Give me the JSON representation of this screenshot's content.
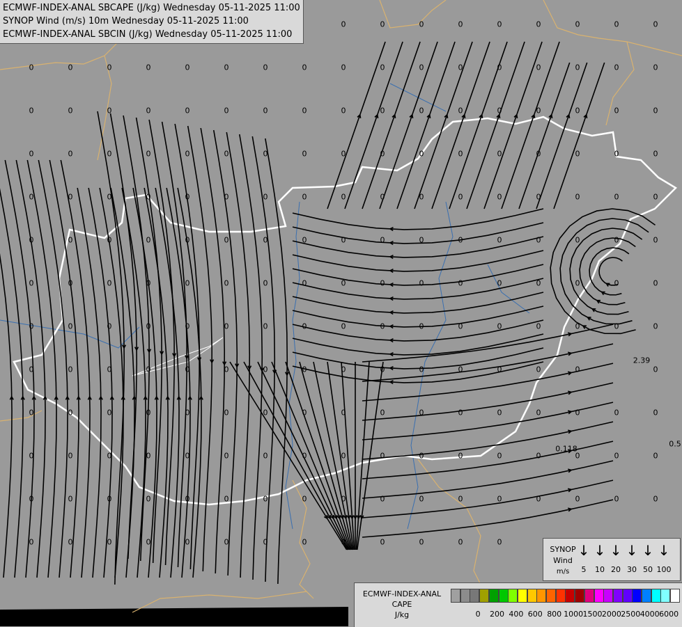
{
  "header": {
    "lines": [
      "ECMWF-INDEX-ANAL SBCAPE (J/kg) Wednesday 05-11-2025 11:00",
      "SYNOP Wind (m/s) 10m Wednesday 05-11-2025 11:00",
      "ECMWF-INDEX-ANAL SBCIN (J/kg) Wednesday 05-11-2025 11:00"
    ]
  },
  "map": {
    "colors": {
      "background": "#9a9a9a",
      "hungary_border": "#ffffff",
      "country_borders": "#d9b26f",
      "rivers": "#3a6fb0",
      "streamlines": "#000000"
    },
    "labels": [
      "0",
      "2.39",
      "0.118",
      "0.5"
    ]
  },
  "synop_legend": {
    "title": "SYNOP",
    "subtitle": "Wind",
    "unit": "m/s",
    "icon": "down-arrow-icon",
    "speeds": [
      "5",
      "10",
      "20",
      "30",
      "50",
      "100"
    ]
  },
  "cape_legend": {
    "title1": "ECMWF-INDEX-ANAL",
    "title2": "CAPE",
    "unit": "J/kg",
    "colors": [
      "#a0a0a0",
      "#8c8c8c",
      "#787878",
      "#a0a000",
      "#00a000",
      "#00c800",
      "#80ff00",
      "#ffff00",
      "#ffc800",
      "#ff9600",
      "#ff6400",
      "#ff3200",
      "#c80000",
      "#a00000",
      "#e0007d",
      "#ff00ff",
      "#c800ff",
      "#8000ff",
      "#6000ff",
      "#0000ff",
      "#0080ff",
      "#00ffff",
      "#80ffff",
      "#ffffff"
    ],
    "ticks": [
      "0",
      "200",
      "400",
      "600",
      "800",
      "1000",
      "1500",
      "2000",
      "2500",
      "4000",
      "6000"
    ]
  }
}
